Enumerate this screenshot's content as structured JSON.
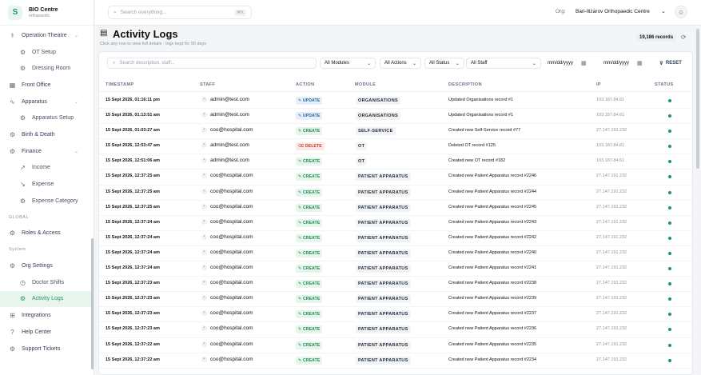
{
  "brand": {
    "logo": "S",
    "name": "BIO Centre",
    "subtitle": "orthopaedic"
  },
  "sidebar": {
    "items": [
      {
        "label": "Operation Theatre",
        "icon": "stethoscope-icon",
        "sub": false,
        "chevron": true
      },
      {
        "label": "OT Setup",
        "icon": "gear-icon",
        "sub": true
      },
      {
        "label": "Dressing Room",
        "icon": "gear-icon",
        "sub": true
      },
      {
        "label": "Front Office",
        "icon": "building-icon",
        "sub": false
      },
      {
        "label": "Apparatus",
        "icon": "pulse-icon",
        "sub": false,
        "chevron": true
      },
      {
        "label": "Apparatus Setup",
        "icon": "gear-icon",
        "sub": true
      },
      {
        "label": "Birth & Death",
        "icon": "gear-icon",
        "sub": false
      },
      {
        "label": "Finance",
        "icon": "gear-icon",
        "sub": false,
        "chevron": true
      },
      {
        "label": "Income",
        "icon": "trend-up-icon",
        "sub": true
      },
      {
        "label": "Expense",
        "icon": "trend-down-icon",
        "sub": true
      },
      {
        "label": "Expense Category",
        "icon": "gear-icon",
        "sub": true
      }
    ],
    "section_global": "GLOBAL",
    "global_items": [
      {
        "label": "Roles & Access",
        "icon": "gear-icon"
      }
    ],
    "section_system": "System",
    "system_items": [
      {
        "label": "Org Settings",
        "icon": "gear-icon",
        "sub": false
      },
      {
        "label": "Doctor Shifts",
        "icon": "clock-icon",
        "sub": true
      },
      {
        "label": "Activity Logs",
        "icon": "gear-icon",
        "sub": true,
        "active": true
      },
      {
        "label": "Integrations",
        "icon": "grid-icon",
        "sub": false
      },
      {
        "label": "Help Center",
        "icon": "help-icon",
        "sub": false
      },
      {
        "label": "Support Tickets",
        "icon": "gear-icon",
        "sub": false
      }
    ]
  },
  "topbar": {
    "search_placeholder": "Search everything...",
    "search_shortcut": "⌘K",
    "org_label": "Org:",
    "org_name": "Bari-Ilizarov Orthopaedic Centre"
  },
  "page": {
    "title": "Activity Logs",
    "subtitle": "Click any row to view full details · logs kept for 90 days",
    "records": "19,186 records"
  },
  "filters": {
    "search_placeholder": "Search description, staff...",
    "modules": "All Modules",
    "actions": "All Actions",
    "status": "All Status",
    "staff": "All Staff",
    "date_from": "mm/dd/yyyy",
    "date_to": "mm/dd/yyyy",
    "reset": "RESET"
  },
  "table": {
    "headers": {
      "timestamp": "TIMESTAMP",
      "staff": "STAFF",
      "action": "ACTION",
      "module": "MODULE",
      "description": "DESCRIPTION",
      "ip": "IP",
      "status": "STATUS"
    },
    "rows": [
      {
        "ts": "15 Sept 2026, 01:16:11 pm",
        "staff": "admin@test.com",
        "action": "UPDATE",
        "module": "ORGANISATIONS",
        "desc": "Updated Organisations record #1",
        "ip": "103.187.84.61"
      },
      {
        "ts": "15 Sept 2026, 01:13:51 am",
        "staff": "admin@test.com",
        "action": "UPDATE",
        "module": "ORGANISATIONS",
        "desc": "Updated Organisations record #1",
        "ip": "103.187.84.61"
      },
      {
        "ts": "15 Sept 2026, 01:03:27 am",
        "staff": "coo@hospital.com",
        "action": "CREATE",
        "module": "SELF-SERVICE",
        "desc": "Created new Self-Service record #77",
        "ip": "27.147.191.232"
      },
      {
        "ts": "15 Sept 2026, 12:53:47 am",
        "staff": "admin@test.com",
        "action": "DELETE",
        "module": "OT",
        "desc": "Deleted OT record #125",
        "ip": "103.187.84.61"
      },
      {
        "ts": "15 Sept 2026, 12:51:06 am",
        "staff": "admin@test.com",
        "action": "CREATE",
        "module": "OT",
        "desc": "Created new OT record #182",
        "ip": "103.187.84.61"
      },
      {
        "ts": "15 Sept 2026, 12:37:25 am",
        "staff": "coo@hospital.com",
        "action": "CREATE",
        "module": "PATIENT APPARATUS",
        "desc": "Created new Patient Apparatus record #2246",
        "ip": "27.147.191.232"
      },
      {
        "ts": "15 Sept 2026, 12:37:25 am",
        "staff": "coo@hospital.com",
        "action": "CREATE",
        "module": "PATIENT APPARATUS",
        "desc": "Created new Patient Apparatus record #2244",
        "ip": "27.147.191.232"
      },
      {
        "ts": "15 Sept 2026, 12:37:25 am",
        "staff": "coo@hospital.com",
        "action": "CREATE",
        "module": "PATIENT APPARATUS",
        "desc": "Created new Patient Apparatus record #2245",
        "ip": "27.147.191.232"
      },
      {
        "ts": "15 Sept 2026, 12:37:24 am",
        "staff": "coo@hospital.com",
        "action": "CREATE",
        "module": "PATIENT APPARATUS",
        "desc": "Created new Patient Apparatus record #2243",
        "ip": "27.147.191.232"
      },
      {
        "ts": "15 Sept 2026, 12:37:24 am",
        "staff": "coo@hospital.com",
        "action": "CREATE",
        "module": "PATIENT APPARATUS",
        "desc": "Created new Patient Apparatus record #2242",
        "ip": "27.147.191.232"
      },
      {
        "ts": "15 Sept 2026, 12:37:24 am",
        "staff": "coo@hospital.com",
        "action": "CREATE",
        "module": "PATIENT APPARATUS",
        "desc": "Created new Patient Apparatus record #2240",
        "ip": "27.147.191.232"
      },
      {
        "ts": "15 Sept 2026, 12:37:24 am",
        "staff": "coo@hospital.com",
        "action": "CREATE",
        "module": "PATIENT APPARATUS",
        "desc": "Created new Patient Apparatus record #2241",
        "ip": "27.147.191.232"
      },
      {
        "ts": "15 Sept 2026, 12:37:23 am",
        "staff": "coo@hospital.com",
        "action": "CREATE",
        "module": "PATIENT APPARATUS",
        "desc": "Created new Patient Apparatus record #2238",
        "ip": "27.147.191.232"
      },
      {
        "ts": "15 Sept 2026, 12:37:23 am",
        "staff": "coo@hospital.com",
        "action": "CREATE",
        "module": "PATIENT APPARATUS",
        "desc": "Created new Patient Apparatus record #2239",
        "ip": "27.147.191.232"
      },
      {
        "ts": "15 Sept 2026, 12:37:23 am",
        "staff": "coo@hospital.com",
        "action": "CREATE",
        "module": "PATIENT APPARATUS",
        "desc": "Created new Patient Apparatus record #2237",
        "ip": "27.147.191.232"
      },
      {
        "ts": "15 Sept 2026, 12:37:23 am",
        "staff": "coo@hospital.com",
        "action": "CREATE",
        "module": "PATIENT APPARATUS",
        "desc": "Created new Patient Apparatus record #2236",
        "ip": "27.147.191.232"
      },
      {
        "ts": "15 Sept 2026, 12:37:22 am",
        "staff": "coo@hospital.com",
        "action": "CREATE",
        "module": "PATIENT APPARATUS",
        "desc": "Created new Patient Apparatus record #2235",
        "ip": "27.147.191.232"
      },
      {
        "ts": "15 Sept 2026, 12:37:22 am",
        "staff": "coo@hospital.com",
        "action": "CREATE",
        "module": "PATIENT APPARATUS",
        "desc": "Created new Patient Apparatus record #2234",
        "ip": "27.147.191.232"
      }
    ]
  },
  "colors": {
    "accent": "#1d9a5c",
    "status_ok": "#1d9a5c",
    "delete": "#c0392b",
    "update": "#1f5f9f"
  }
}
